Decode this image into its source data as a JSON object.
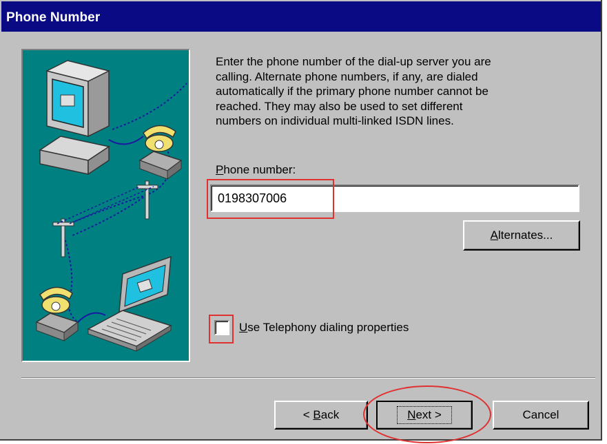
{
  "window": {
    "title": "Phone Number"
  },
  "description": "Enter the phone number of the dial-up server you are\ncalling.  Alternate phone numbers, if any, are dialed\nautomatically if the primary phone number cannot be\nreached.  They may also be used to set different\nnumbers on individual multi-linked ISDN lines.",
  "phone": {
    "label_accel": "P",
    "label_rest": "hone number:",
    "value": "0198307006"
  },
  "alternates_button": {
    "accel": "A",
    "rest": "lternates..."
  },
  "telephony": {
    "accel": "U",
    "rest": "se Telephony dialing properties",
    "checked": false
  },
  "buttons": {
    "back_prefix": "< ",
    "back_accel": "B",
    "back_rest": "ack",
    "next_accel": "N",
    "next_rest": "ext >",
    "cancel": "Cancel"
  },
  "colors": {
    "titlebar": "#0a0a84",
    "panel": "#008080",
    "annotation": "#e03030"
  },
  "illustration_icons": [
    "desktop-computer-icon",
    "telephone-icon",
    "utility-pole-icon",
    "laptop-icon"
  ]
}
